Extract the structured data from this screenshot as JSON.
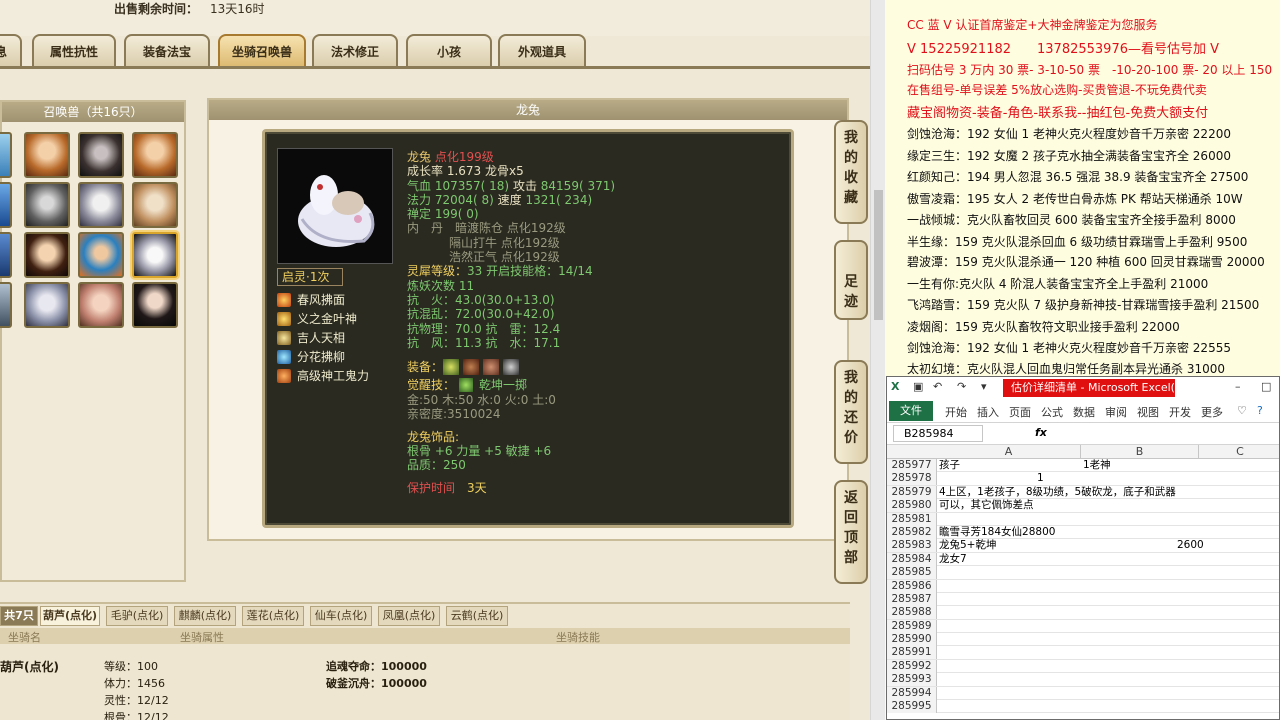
{
  "game": {
    "sell_label": "出售剩余时间：",
    "sell_time": "13天16时",
    "tabs": [
      "息",
      "属性抗性",
      "装备法宝",
      "坐骑召唤兽",
      "法术修正",
      "小孩",
      "外观道具"
    ],
    "active_tab": 3,
    "summon_header": "召唤兽（共16只）",
    "pet_header": "龙兔",
    "pet": {
      "name": "龙兔",
      "level": "点化199级",
      "growth": "成长率 1.673",
      "bone": "龙骨x5",
      "hp_label": "气血",
      "hp": "107357( 18)",
      "atk_label": "攻击",
      "atk": "84159( 371)",
      "mp_label": "法力",
      "mp": "72004( 8)",
      "spd_label": "速度",
      "spd": "1321( 234)",
      "zen_label": "禅定",
      "zen": "199( 0)",
      "dan_label": "内　丹",
      "dan1": "暗渡陈仓 点化192级",
      "dan2": "隔山打牛 点化192级",
      "dan3": "浩然正气 点化192级",
      "spirit_label": "灵犀等级：",
      "spirit": "33 开启技能格：14/14",
      "refine": "炼妖次数 11",
      "res_fire": "抗　火：43.0(30.0+13.0)",
      "res_mix": "抗混乱：72.0(30.0+42.0)",
      "res_phys": "抗物理：70.0 抗　雷：12.4",
      "res_wind": "抗　风：11.3 抗　水：17.1",
      "equip_label": "装备：",
      "awaken_label": "觉醒技：",
      "awaken": "乾坤一掷",
      "elements": "金:50 木:50 水:0 火:0 土:0",
      "intimacy": "亲密度:3510024",
      "acc_label": "龙兔饰品:",
      "acc_stats": "根骨 +6 力量 +5 敏捷 +6",
      "acc_quality": "品质：250",
      "protect_label": "保护时间",
      "protect": "3天",
      "skill_badge": "启灵·1次",
      "skills": [
        "春风拂面",
        "义之金叶神",
        "吉人天相",
        "分花拂柳",
        "高级神工鬼力"
      ]
    },
    "side_buttons": [
      "我的收藏",
      "足迹",
      "我的还价",
      "返回顶部"
    ],
    "mount_count": "共7只",
    "mount_tabs": [
      "葫芦(点化)",
      "毛驴(点化)",
      "麒麟(点化)",
      "莲花(点化)",
      "仙车(点化)",
      "凤凰(点化)",
      "云鹤(点化)"
    ],
    "mount_headers": [
      "坐骑名",
      "坐骑属性",
      "坐骑技能"
    ],
    "mount_name": "葫芦(点化)",
    "mount_stats": [
      "等级：100",
      "体力：1456",
      "灵性：12/12",
      "根骨：12/12"
    ],
    "mount_skills": [
      "追魂夺命：100000",
      "破釜沉舟：100000"
    ]
  },
  "notes": {
    "lines": [
      "CC 蓝 V 认证首席鉴定+大神金牌鉴定为您服务",
      "V 15225921182　　13782553976—看号估号加 V",
      "扫码估号 3 万内 30 票- 3-10-50 票　-10-20-100 票- 20 以上 150",
      "在售组号-单号误差 5%放心选购-买贵管退-不玩免费代卖",
      "藏宝阁物资-装备-角色-联系我--抽红包-免费大额支付",
      "剑蚀沧海：192 女仙 1 老神火克火程度妙音千万亲密 22200",
      "缘定三生：192 女魔 2 孩子克水抽全满装备宝宝齐全 26000",
      "红颜知己：194 男人忽混 36.5 强混 38.9 装备宝宝齐全 27500",
      "傲雪凌霜：195 女人 2 老传世白骨赤炼 PK 帮站天梯通杀 10W",
      "一战倾城：克火队畜牧回灵 600 装备宝宝齐全接手盈利 8000",
      "半生缘：159 克火队混杀回血 6 级功绩甘霖瑞雪上手盈利 9500",
      "碧波潭：159 克火队混杀通一 120 种植 600 回灵甘霖瑞雪 20000",
      "一生有你:克火队 4 阶混人装备宝宝齐全上手盈利 21000",
      "飞鸿踏雪：159 克火队 7 级护身新神技-甘霖瑞雪接手盈利 21500",
      "凌烟阁：159 克火队畜牧符文职业接手盈利 22000",
      "剑蚀沧海：192 女仙 1 老神火克火程度妙音千万亲密 22555",
      "太初幻境：克火队混人回血鬼归常任务副本异光通杀 31000"
    ]
  },
  "excel": {
    "title": "估价详细清单 - Microsoft Excel(...",
    "ribbon": [
      "文件",
      "开始",
      "插入",
      "页面",
      "公式",
      "数据",
      "审阅",
      "视图",
      "开发",
      "更多"
    ],
    "namebox": "B285984",
    "fx": "fx",
    "cols": [
      "A",
      "B",
      "C"
    ],
    "rows": [
      {
        "n": "285977",
        "a": "孩子",
        "b": "1老神"
      },
      {
        "n": "285978",
        "a": "",
        "b": "",
        "num": "1"
      },
      {
        "n": "285979",
        "a": "4上区，1老孩子，8级功绩，5破砍龙，底子和武器",
        "b": ""
      },
      {
        "n": "285980",
        "a": "可以，其它佩饰差点",
        "b": ""
      },
      {
        "n": "285981",
        "a": "",
        "b": ""
      },
      {
        "n": "285982",
        "a": "瞻雪寻芳184女仙28800",
        "b": ""
      },
      {
        "n": "285983",
        "a": "龙兔5+乾坤",
        "b": "2600"
      },
      {
        "n": "285984",
        "a": "龙女7",
        "b": ""
      },
      {
        "n": "285985",
        "a": "",
        "b": ""
      },
      {
        "n": "285986",
        "a": "",
        "b": ""
      },
      {
        "n": "285987",
        "a": "",
        "b": ""
      },
      {
        "n": "285988",
        "a": "",
        "b": ""
      },
      {
        "n": "285989",
        "a": "",
        "b": ""
      },
      {
        "n": "285990",
        "a": "",
        "b": ""
      },
      {
        "n": "285991",
        "a": "",
        "b": ""
      },
      {
        "n": "285992",
        "a": "",
        "b": ""
      },
      {
        "n": "285993",
        "a": "",
        "b": ""
      },
      {
        "n": "285994",
        "a": "",
        "b": ""
      },
      {
        "n": "285995",
        "a": "",
        "b": ""
      }
    ]
  },
  "colors": {
    "accent_red": "#e0101a",
    "excel_green": "#1e7145",
    "panel_bg": "#2a2a20",
    "tab_border": "#8a7a55"
  }
}
